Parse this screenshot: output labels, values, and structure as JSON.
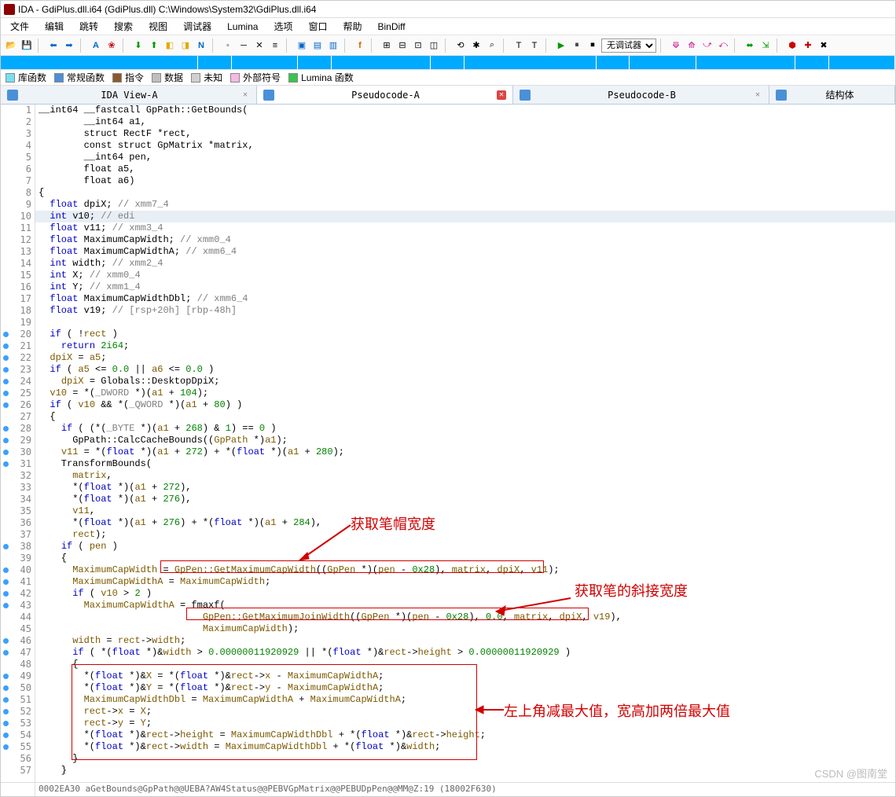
{
  "window": {
    "title": "IDA - GdiPlus.dll.i64 (GdiPlus.dll) C:\\Windows\\System32\\GdiPlus.dll.i64"
  },
  "menu": [
    "文件",
    "编辑",
    "跳转",
    "搜索",
    "视图",
    "调试器",
    "Lumina",
    "选项",
    "窗口",
    "帮助",
    "BinDiff"
  ],
  "debugger_select": "无调试器",
  "legend": [
    {
      "color": "#76e0f0",
      "label": "库函数"
    },
    {
      "color": "#4a90d9",
      "label": "常规函数"
    },
    {
      "color": "#8a5a2b",
      "label": "指令"
    },
    {
      "color": "#bfbfbf",
      "label": "数据"
    },
    {
      "color": "#d0d0d0",
      "label": "未知"
    },
    {
      "color": "#f8b8e4",
      "label": "外部符号"
    },
    {
      "color": "#3ac44a",
      "label": "Lumina 函数"
    }
  ],
  "tabs": [
    {
      "label": "IDA View-A",
      "active": false,
      "red": false
    },
    {
      "label": "Pseudocode-A",
      "active": true,
      "red": true
    },
    {
      "label": "Pseudocode-B",
      "active": false,
      "red": false
    },
    {
      "label": "结构体",
      "active": false,
      "red": false
    }
  ],
  "annotations": {
    "a1": "获取笔帽宽度",
    "a2": "获取笔的斜接宽度",
    "a3": "左上角减最大值，宽高加两倍最大值"
  },
  "code": [
    {
      "n": 1,
      "bp": false,
      "hl": false,
      "html": "__int64 __fastcall GpPath::GetBounds("
    },
    {
      "n": 2,
      "bp": false,
      "hl": false,
      "html": "        __int64 a1,"
    },
    {
      "n": 3,
      "bp": false,
      "hl": false,
      "html": "        struct RectF *rect,"
    },
    {
      "n": 4,
      "bp": false,
      "hl": false,
      "html": "        const struct GpMatrix *matrix,"
    },
    {
      "n": 5,
      "bp": false,
      "hl": false,
      "html": "        __int64 pen,"
    },
    {
      "n": 6,
      "bp": false,
      "hl": false,
      "html": "        float a5,"
    },
    {
      "n": 7,
      "bp": false,
      "hl": false,
      "html": "        float a6)"
    },
    {
      "n": 8,
      "bp": false,
      "hl": false,
      "html": "{"
    },
    {
      "n": 9,
      "bp": false,
      "hl": false,
      "html": "  <span class='kw'>float</span> dpiX; <span class='comm'>// xmm7_4</span>"
    },
    {
      "n": 10,
      "bp": false,
      "hl": true,
      "html": "  <span class='kw'>int</span> v10; <span class='comm'>// edi</span>"
    },
    {
      "n": 11,
      "bp": false,
      "hl": false,
      "html": "  <span class='kw'>float</span> v11; <span class='comm'>// xmm3_4</span>"
    },
    {
      "n": 12,
      "bp": false,
      "hl": false,
      "html": "  <span class='kw'>float</span> MaximumCapWidth; <span class='comm'>// xmm0_4</span>"
    },
    {
      "n": 13,
      "bp": false,
      "hl": false,
      "html": "  <span class='kw'>float</span> MaximumCapWidthA; <span class='comm'>// xmm6_4</span>"
    },
    {
      "n": 14,
      "bp": false,
      "hl": false,
      "html": "  <span class='kw'>int</span> width; <span class='comm'>// xmm2_4</span>"
    },
    {
      "n": 15,
      "bp": false,
      "hl": false,
      "html": "  <span class='kw'>int</span> X; <span class='comm'>// xmm0_4</span>"
    },
    {
      "n": 16,
      "bp": false,
      "hl": false,
      "html": "  <span class='kw'>int</span> Y; <span class='comm'>// xmm1_4</span>"
    },
    {
      "n": 17,
      "bp": false,
      "hl": false,
      "html": "  <span class='kw'>float</span> MaximumCapWidthDbl; <span class='comm'>// xmm6_4</span>"
    },
    {
      "n": 18,
      "bp": false,
      "hl": false,
      "html": "  <span class='kw'>float</span> v19; <span class='comm'>// [rsp+20h] [rbp-48h]</span>"
    },
    {
      "n": 19,
      "bp": false,
      "hl": false,
      "html": ""
    },
    {
      "n": 20,
      "bp": true,
      "hl": false,
      "html": "  <span class='kw'>if</span> ( !<span class='id'>rect</span> )"
    },
    {
      "n": 21,
      "bp": true,
      "hl": false,
      "html": "    <span class='kw'>return</span> <span class='num'>2i64</span>;"
    },
    {
      "n": 22,
      "bp": true,
      "hl": false,
      "html": "  <span class='id'>dpiX</span> = <span class='id'>a5</span>;"
    },
    {
      "n": 23,
      "bp": true,
      "hl": false,
      "html": "  <span class='kw'>if</span> ( <span class='id'>a5</span> &lt;= <span class='num'>0.0</span> || <span class='id'>a6</span> &lt;= <span class='num'>0.0</span> )"
    },
    {
      "n": 24,
      "bp": true,
      "hl": false,
      "html": "    <span class='id'>dpiX</span> = Globals::DesktopDpiX;"
    },
    {
      "n": 25,
      "bp": true,
      "hl": false,
      "html": "  <span class='id'>v10</span> = *(<span class='gc'>_DWORD</span> *)(<span class='id'>a1</span> + <span class='num'>104</span>);"
    },
    {
      "n": 26,
      "bp": true,
      "hl": false,
      "html": "  <span class='kw'>if</span> ( <span class='id'>v10</span> &amp;&amp; *(<span class='gc'>_QWORD</span> *)(<span class='id'>a1</span> + <span class='num'>80</span>) )"
    },
    {
      "n": 27,
      "bp": false,
      "hl": false,
      "html": "  {"
    },
    {
      "n": 28,
      "bp": true,
      "hl": false,
      "html": "    <span class='kw'>if</span> ( (*(<span class='gc'>_BYTE</span> *)(<span class='id'>a1</span> + <span class='num'>268</span>) &amp; <span class='num'>1</span>) == <span class='num'>0</span> )"
    },
    {
      "n": 29,
      "bp": true,
      "hl": false,
      "html": "      GpPath::CalcCacheBounds((<span class='id'>GpPath</span> *)<span class='id'>a1</span>);"
    },
    {
      "n": 30,
      "bp": true,
      "hl": false,
      "html": "    <span class='id'>v11</span> = *(<span class='kw'>float</span> *)(<span class='id'>a1</span> + <span class='num'>272</span>) + *(<span class='kw'>float</span> *)(<span class='id'>a1</span> + <span class='num'>280</span>);"
    },
    {
      "n": 31,
      "bp": true,
      "hl": false,
      "html": "    TransformBounds("
    },
    {
      "n": 32,
      "bp": false,
      "hl": false,
      "html": "      <span class='id'>matrix</span>,"
    },
    {
      "n": 33,
      "bp": false,
      "hl": false,
      "html": "      *(<span class='kw'>float</span> *)(<span class='id'>a1</span> + <span class='num'>272</span>),"
    },
    {
      "n": 34,
      "bp": false,
      "hl": false,
      "html": "      *(<span class='kw'>float</span> *)(<span class='id'>a1</span> + <span class='num'>276</span>),"
    },
    {
      "n": 35,
      "bp": false,
      "hl": false,
      "html": "      <span class='id'>v11</span>,"
    },
    {
      "n": 36,
      "bp": false,
      "hl": false,
      "html": "      *(<span class='kw'>float</span> *)(<span class='id'>a1</span> + <span class='num'>276</span>) + *(<span class='kw'>float</span> *)(<span class='id'>a1</span> + <span class='num'>284</span>),"
    },
    {
      "n": 37,
      "bp": false,
      "hl": false,
      "html": "      <span class='id'>rect</span>);"
    },
    {
      "n": 38,
      "bp": true,
      "hl": false,
      "html": "    <span class='kw'>if</span> ( <span class='id'>pen</span> )"
    },
    {
      "n": 39,
      "bp": false,
      "hl": false,
      "html": "    {"
    },
    {
      "n": 40,
      "bp": true,
      "hl": false,
      "html": "      <span class='id'>MaximumCapWidth</span> = <span class='pp'>GpPen::GetMaximumCapWidth</span>((<span class='id'>GpPen</span> *)(<span class='id'>pen</span> - <span class='num'>0x28</span>), <span class='id'>matrix</span>, <span class='id'>dpiX</span>, <span class='id'>v11</span>);"
    },
    {
      "n": 41,
      "bp": true,
      "hl": false,
      "html": "      <span class='id'>MaximumCapWidthA</span> = <span class='id'>MaximumCapWidth</span>;"
    },
    {
      "n": 42,
      "bp": true,
      "hl": false,
      "html": "      <span class='kw'>if</span> ( <span class='id'>v10</span> &gt; <span class='num'>2</span> )"
    },
    {
      "n": 43,
      "bp": true,
      "hl": false,
      "html": "        <span class='id'>MaximumCapWidthA</span> = fmaxf("
    },
    {
      "n": 44,
      "bp": false,
      "hl": false,
      "html": "                             <span class='pp'>GpPen::GetMaximumJoinWidth</span>((<span class='id'>GpPen</span> *)(<span class='id'>pen</span> - <span class='num'>0x28</span>), <span class='num'>0.0</span>, <span class='id'>matrix</span>, <span class='id'>dpiX</span>, <span class='id'>v19</span>),"
    },
    {
      "n": 45,
      "bp": false,
      "hl": false,
      "html": "                             <span class='id'>MaximumCapWidth</span>);"
    },
    {
      "n": 46,
      "bp": true,
      "hl": false,
      "html": "      <span class='id'>width</span> = <span class='id'>rect</span>-&gt;<span class='id'>width</span>;"
    },
    {
      "n": 47,
      "bp": true,
      "hl": false,
      "html": "      <span class='kw'>if</span> ( *(<span class='kw'>float</span> *)&amp;<span class='id'>width</span> &gt; <span class='num'>0.00000011920929</span> || *(<span class='kw'>float</span> *)&amp;<span class='id'>rect</span>-&gt;<span class='id'>height</span> &gt; <span class='num'>0.00000011920929</span> )"
    },
    {
      "n": 48,
      "bp": false,
      "hl": false,
      "html": "      {"
    },
    {
      "n": 49,
      "bp": true,
      "hl": false,
      "html": "        *(<span class='kw'>float</span> *)&amp;<span class='id'>X</span> = *(<span class='kw'>float</span> *)&amp;<span class='id'>rect</span>-&gt;<span class='id'>x</span> - <span class='id'>MaximumCapWidthA</span>;"
    },
    {
      "n": 50,
      "bp": true,
      "hl": false,
      "html": "        *(<span class='kw'>float</span> *)&amp;<span class='id'>Y</span> = *(<span class='kw'>float</span> *)&amp;<span class='id'>rect</span>-&gt;<span class='id'>y</span> - <span class='id'>MaximumCapWidthA</span>;"
    },
    {
      "n": 51,
      "bp": true,
      "hl": false,
      "html": "        <span class='id'>MaximumCapWidthDbl</span> = <span class='id'>MaximumCapWidthA</span> + <span class='id'>MaximumCapWidthA</span>;"
    },
    {
      "n": 52,
      "bp": true,
      "hl": false,
      "html": "        <span class='id'>rect</span>-&gt;<span class='id'>x</span> = <span class='id'>X</span>;"
    },
    {
      "n": 53,
      "bp": true,
      "hl": false,
      "html": "        <span class='id'>rect</span>-&gt;<span class='id'>y</span> = <span class='id'>Y</span>;"
    },
    {
      "n": 54,
      "bp": true,
      "hl": false,
      "html": "        *(<span class='kw'>float</span> *)&amp;<span class='id'>rect</span>-&gt;<span class='id'>height</span> = <span class='id'>MaximumCapWidthDbl</span> + *(<span class='kw'>float</span> *)&amp;<span class='id'>rect</span>-&gt;<span class='id'>height</span>;"
    },
    {
      "n": 55,
      "bp": true,
      "hl": false,
      "html": "        *(<span class='kw'>float</span> *)&amp;<span class='id'>rect</span>-&gt;<span class='id'>width</span> = <span class='id'>MaximumCapWidthDbl</span> + *(<span class='kw'>float</span> *)&amp;<span class='id'>width</span>;"
    },
    {
      "n": 56,
      "bp": false,
      "hl": false,
      "html": "      }"
    },
    {
      "n": 57,
      "bp": false,
      "hl": false,
      "html": "    }"
    }
  ],
  "status": "0002EA30 aGetBounds@GpPath@@UEBA?AW4Status@@PEBVGpMatrix@@PEBUDpPen@@MM@Z:19 (18002F630)",
  "watermark": "CSDN @图南堂"
}
